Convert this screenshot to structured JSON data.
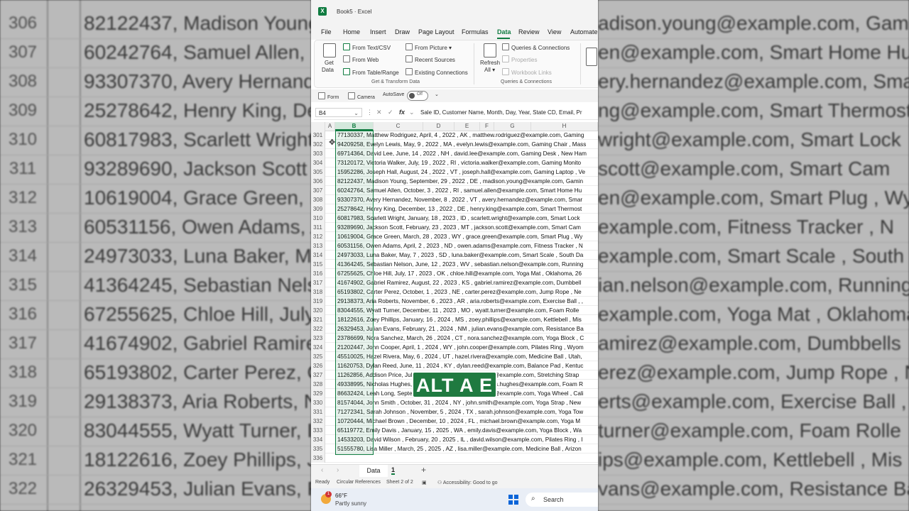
{
  "window": {
    "title": "Book5  ·  Excel",
    "app_icon": "excel-logo-icon",
    "accent": "#107c41"
  },
  "menu": [
    "File",
    "Home",
    "Insert",
    "Draw",
    "Page Layout",
    "Formulas",
    "Data",
    "Review",
    "View",
    "Automate"
  ],
  "menu_active": "Data",
  "ribbon": {
    "get_data_label": "Get",
    "get_data_label2": "Data",
    "from_text_csv": "From Text/CSV",
    "from_web": "From Web",
    "from_table_range": "From Table/Range",
    "from_picture": "From Picture",
    "recent_sources": "Recent Sources",
    "existing_connections": "Existing Connections",
    "group_get_transform": "Get & Transform Data",
    "refresh_all_label": "Refresh",
    "refresh_all_label2": "All",
    "queries_connections": "Queries & Connections",
    "properties": "Properties",
    "workbook_links": "Workbook Links",
    "group_queries": "Queries & Connections"
  },
  "qat": {
    "form": "Form",
    "camera": "Camera",
    "autosave": "AutoSave",
    "autosave_state": "Off"
  },
  "formula_bar": {
    "name_box": "B4",
    "fx": "fx",
    "content": "Sale ID, Customer Name, Month, Day, Year, State CD, Email, Pr"
  },
  "columns": [
    "A",
    "B",
    "C",
    "D",
    "E",
    "F",
    "G",
    "H"
  ],
  "selected_column": "B",
  "rows": [
    {
      "n": "301",
      "text": "77130337, Matthew Rodriguez, April, 4 , 2022 , AK , matthew.rodriguez@example.com, Gaming"
    },
    {
      "n": "302",
      "text": "94209258, Evelyn Lewis, May, 9 , 2022 , MA , evelyn.lewis@example.com, Gaming Chair , Mass"
    },
    {
      "n": "303",
      "text": "69714364, David Lee, June, 14 , 2022 , NH , david.lee@example.com, Gaming Desk , New Ham"
    },
    {
      "n": "304",
      "text": "73120172, Victoria Walker, July, 19 , 2022 , RI , victoria.walker@example.com, Gaming Monito"
    },
    {
      "n": "305",
      "text": "15952286, Joseph Hall, August, 24 , 2022 , VT , joseph.hall@example.com, Gaming Laptop , Ve"
    },
    {
      "n": "306",
      "text": "82122437, Madison Young, September, 29 , 2022 , DE , madison.young@example.com, Gamin"
    },
    {
      "n": "307",
      "text": "60242764, Samuel Allen, October, 3 , 2022 , RI , samuel.allen@example.com, Smart Home Hu"
    },
    {
      "n": "308",
      "text": "93307370, Avery Hernandez, November, 8 , 2022 , VT , avery.hernandez@example.com, Smar"
    },
    {
      "n": "309",
      "text": "25278642, Henry King, December, 13 , 2022 , DE , henry.king@example.com, Smart Thermost"
    },
    {
      "n": "310",
      "text": "60817983, Scarlett Wright, January, 18 , 2023 , ID , scarlett.wright@example.com, Smart Lock"
    },
    {
      "n": "311",
      "text": "93289690, Jackson Scott, February, 23 , 2023 , MT , jackson.scott@example.com, Smart Cam"
    },
    {
      "n": "312",
      "text": "10619004, Grace Green, March, 28 , 2023 , WY , grace.green@example.com, Smart Plug , Wy"
    },
    {
      "n": "313",
      "text": "60531156, Owen Adams, April, 2 , 2023 , ND , owen.adams@example.com, Fitness Tracker , N"
    },
    {
      "n": "314",
      "text": "24973033, Luna Baker, May, 7 , 2023 , SD , luna.baker@example.com, Smart Scale , South Da"
    },
    {
      "n": "315",
      "text": "41364245, Sebastian Nelson, June, 12 , 2023 , WV , sebastian.nelson@example.com, Running"
    },
    {
      "n": "316",
      "text": "67255625, Chloe Hill, July, 17 , 2023 , OK , chloe.hill@example.com, Yoga Mat , Oklahoma, 26"
    },
    {
      "n": "317",
      "text": "41674902, Gabriel Ramirez, August, 22 , 2023 , KS , gabriel.ramirez@example.com, Dumbbell"
    },
    {
      "n": "318",
      "text": "65193802, Carter Perez, October, 1 , 2023 , NE , carter.perez@example.com, Jump Rope , Ne"
    },
    {
      "n": "319",
      "text": "29138373, Aria Roberts, November, 6 , 2023 , AR , aria.roberts@example.com, Exercise Ball , ,"
    },
    {
      "n": "320",
      "text": "83044555, Wyatt Turner, December, 11 , 2023 , MO , wyatt.turner@example.com, Foam Rolle"
    },
    {
      "n": "321",
      "text": "18122616, Zoey Phillips, January, 16 , 2024 , MS , zoey.phillips@example.com, Kettlebell , Mis"
    },
    {
      "n": "322",
      "text": "26329453, Julian Evans, February, 21 , 2024 , NM , julian.evans@example.com, Resistance Ba"
    },
    {
      "n": "323",
      "text": "23786699, Nora Sanchez, March, 26 , 2024 , CT , nora.sanchez@example.com, Yoga Block , C"
    },
    {
      "n": "324",
      "text": "21202447, John Cooper, April, 1 , 2024 , WY , john.cooper@example.com, Pilates Ring , Wyom"
    },
    {
      "n": "325",
      "text": "45510025, Hazel Rivera, May, 6 , 2024 , UT , hazel.rivera@example.com, Medicine Ball , Utah,"
    },
    {
      "n": "326",
      "text": "11620753, Dylan Reed, June, 11 , 2024 , KY , dylan.reed@example.com, Balance Pad , Kentuc"
    },
    {
      "n": "327",
      "text": "11262856, Addison Price, July, 16 , 2024 , AZ , addison.price@example.com, Stretching Strap"
    },
    {
      "n": "328",
      "text": "49338995, Nicholas Hughes, August, 21 , 2024 , NV , nicholas.hughes@example.com, Foam R"
    },
    {
      "n": "329",
      "text": "86632424, Leah Long, September, 26 , 2024 , CA , leah.long@example.com, Yoga Wheel , Cali"
    },
    {
      "n": "330",
      "text": "81574044, John Smith , October, 31 , 2024 , NY , john.smith@example.com, Yoga Strap , New"
    },
    {
      "n": "331",
      "text": "71272341, Sarah Johnson , November, 5 , 2024 , TX , sarah.johnson@example.com, Yoga Tow"
    },
    {
      "n": "332",
      "text": "10720444, Michael Brown , December, 10 , 2024 , FL , michael.brown@example.com, Yoga M"
    },
    {
      "n": "333",
      "text": "65119772, Emily Davis , January, 15 , 2025 , WA , emily.davis@example.com, Yoga Block , Wa"
    },
    {
      "n": "334",
      "text": "14533203, David Wilson , February, 20 , 2025 , IL , david.wilson@example.com, Pilates Ring , I"
    },
    {
      "n": "335",
      "text": "51555780, Lisa Miller , March, 25 , 2025 , AZ , lisa.miller@example.com, Medicine Ball , Arizon"
    },
    {
      "n": "336",
      "text": ""
    }
  ],
  "caption": "ALT A E",
  "sheet_tabs": {
    "active": "Data",
    "second": "1",
    "add": "+"
  },
  "status": {
    "ready": "Ready",
    "circular": "Circular References",
    "sheet": "Sheet 2 of 2",
    "accessibility": "Accessibility: Good to go"
  },
  "taskbar": {
    "temp": "66°F",
    "weather": "Partly sunny",
    "weather_badge": "1",
    "search": "Search"
  },
  "backdrop_left": [
    {
      "n": "306",
      "text": "82122437, Madison Young"
    },
    {
      "n": "307",
      "text": "60242764, Samuel Allen, O"
    },
    {
      "n": "308",
      "text": "93307370, Avery Hernand"
    },
    {
      "n": "309",
      "text": "25278642, Henry King, De"
    },
    {
      "n": "310",
      "text": "60817983, Scarlett Wright"
    },
    {
      "n": "311",
      "text": "93289690, Jackson Scott"
    },
    {
      "n": "312",
      "text": "10619004, Grace Green, M"
    },
    {
      "n": "313",
      "text": "60531156, Owen Adams, A"
    },
    {
      "n": "314",
      "text": "24973033, Luna Baker, M"
    },
    {
      "n": "315",
      "text": "41364245, Sebastian Nels"
    },
    {
      "n": "316",
      "text": "67255625, Chloe Hill, July"
    },
    {
      "n": "317",
      "text": "41674902, Gabriel Ramire"
    },
    {
      "n": "318",
      "text": "65193802, Carter Perez, C"
    },
    {
      "n": "319",
      "text": "29138373, Aria Roberts, N"
    },
    {
      "n": "320",
      "text": "83044555, Wyatt Turner, I"
    },
    {
      "n": "321",
      "text": "18122616, Zoey Phillips, J"
    },
    {
      "n": "322",
      "text": "26329453, Julian Evans, F"
    }
  ],
  "backdrop_right": [
    "adison.young@example.com, Gamin",
    "en@example.com, Smart Home Hu",
    "ery.hernandez@example.com, Smar",
    "ng@example.com, Smart Thermost",
    "wright@example.com, Smart Lock",
    "scott@example.com, Smart Cam",
    "en@example.com, Smart Plug , Wyo",
    "example.com, Fitness Tracker , N",
    "example.com, Smart Scale , South Da",
    "ian.nelson@example.com, Running",
    "example.com, Yoga Mat , Oklahoma, 26",
    "amirez@example.com, Dumbbells",
    "erez@example.com, Jump Rope , Ne",
    "erts@example.com, Exercise Ball , ,",
    "turner@example.com, Foam Rolle",
    "ips@example.com, Kettlebell , Mis",
    "vans@example.com, Resistance Ba"
  ]
}
